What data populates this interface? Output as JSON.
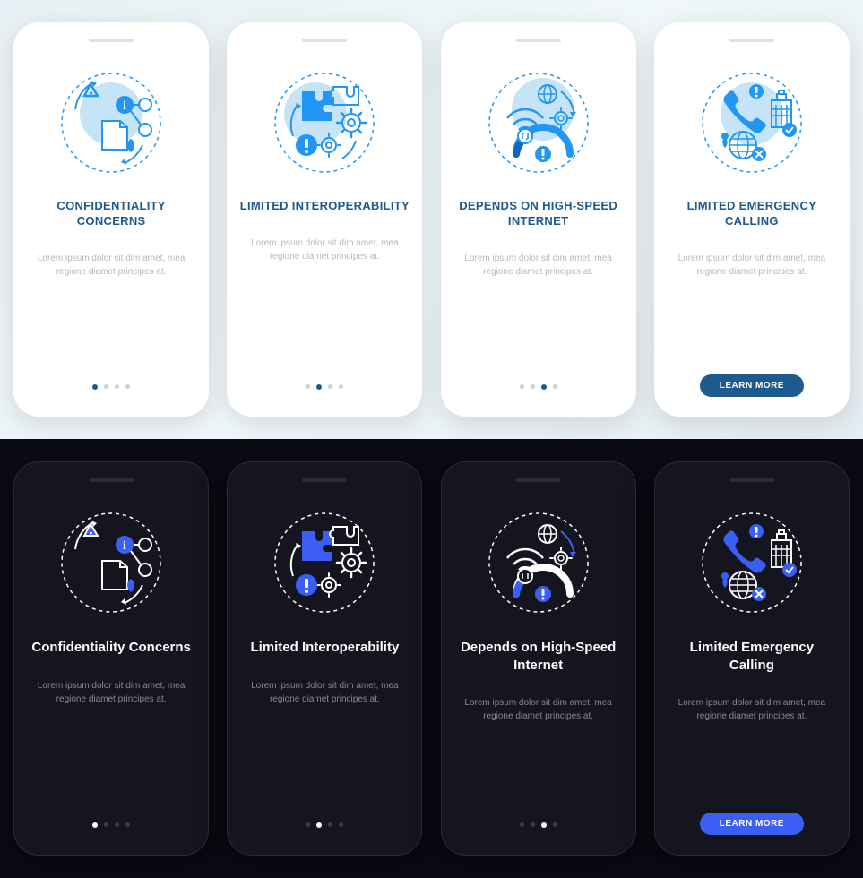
{
  "body_text": "Lorem ipsum dolor sit dim amet, mea regione diamet principes at.",
  "cta": "LEARN MORE",
  "light": {
    "screens": [
      {
        "title": "CONFIDENTIALITY CONCERNS",
        "active_dot": 0,
        "has_cta": false
      },
      {
        "title": "LIMITED INTEROPERABILITY",
        "active_dot": 1,
        "has_cta": false
      },
      {
        "title": "DEPENDS ON HIGH-SPEED INTERNET",
        "active_dot": 2,
        "has_cta": false
      },
      {
        "title": "LIMITED EMERGENCY CALLING",
        "active_dot": null,
        "has_cta": true
      }
    ]
  },
  "dark": {
    "screens": [
      {
        "title": "Confidentiality Concerns",
        "active_dot": 0,
        "has_cta": false
      },
      {
        "title": "Limited Interoperability",
        "active_dot": 1,
        "has_cta": false
      },
      {
        "title": "Depends on High-Speed Internet",
        "active_dot": 2,
        "has_cta": false
      },
      {
        "title": "Limited Emergency Calling",
        "active_dot": null,
        "has_cta": true
      }
    ]
  },
  "colors": {
    "accent_light": "#1e5a8e",
    "accent_dark": "#3b5ff5",
    "icon_blue": "#2196f3",
    "icon_blue_dark": "#3b5ff5"
  }
}
